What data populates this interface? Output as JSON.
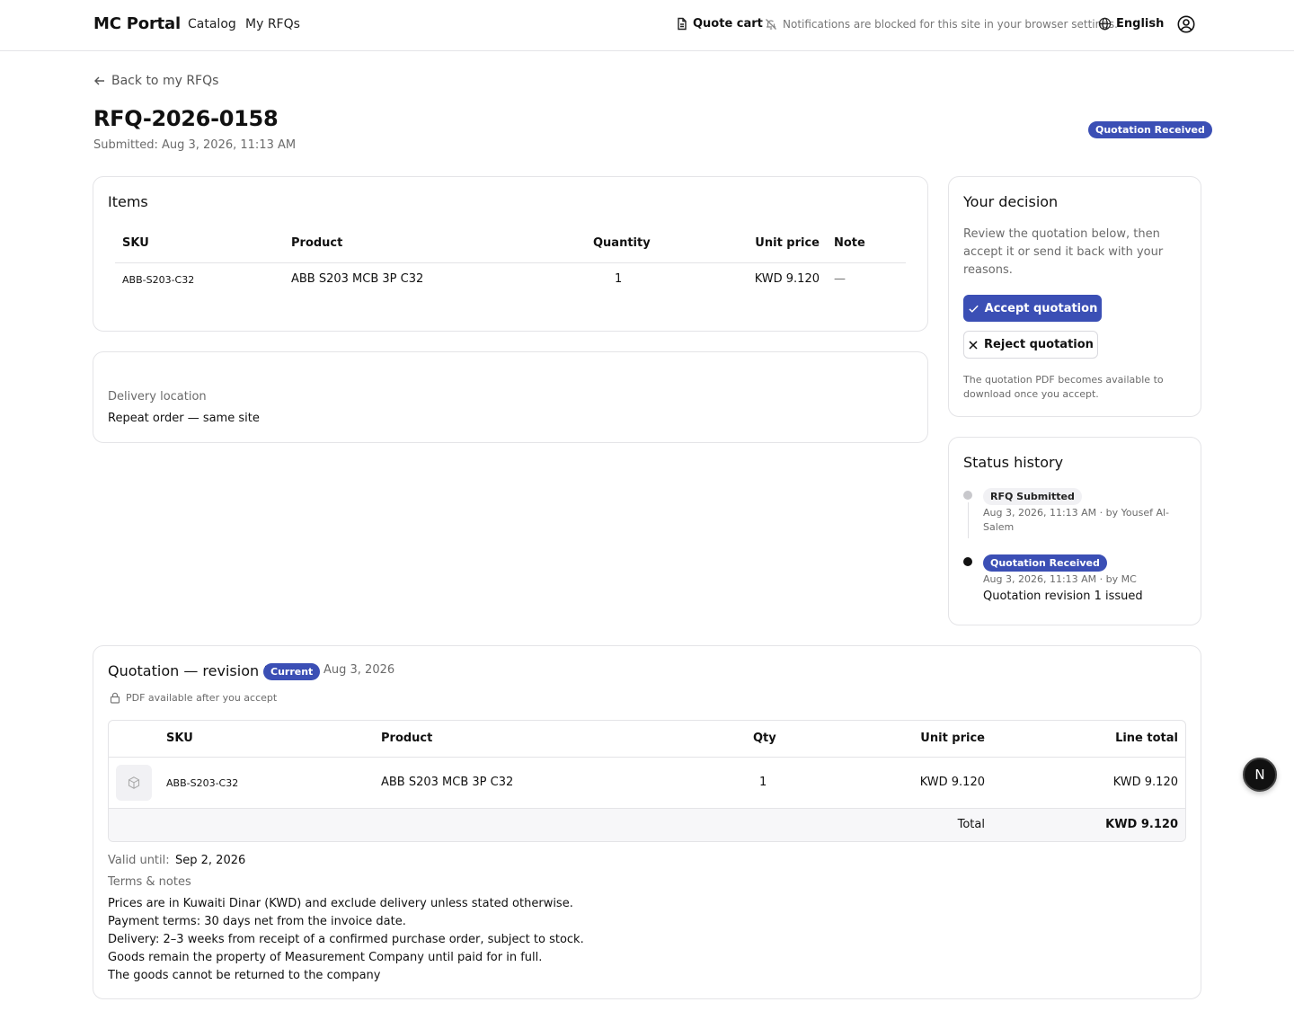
{
  "header": {
    "brand": "MC Portal",
    "nav": {
      "catalog": "Catalog",
      "my_rfqs": "My RFQs"
    },
    "quote_cart": "Quote cart",
    "notifications_text": "Notifications are blocked for this site in your browser settings.",
    "language": "English"
  },
  "page": {
    "back_link": "Back to my RFQs",
    "title": "RFQ-2026-0158",
    "submitted": "Submitted: Aug 3, 2026, 11:13 AM",
    "status": "Quotation Received"
  },
  "items": {
    "title": "Items",
    "columns": {
      "sku": "SKU",
      "product": "Product",
      "quantity": "Quantity",
      "unit_price": "Unit price",
      "note": "Note"
    },
    "rows": [
      {
        "sku": "ABB-S203-C32",
        "product": "ABB S203 MCB 3P C32",
        "quantity": "1",
        "unit_price": "KWD 9.120",
        "note": "—"
      }
    ]
  },
  "delivery": {
    "label": "Delivery location",
    "value": "Repeat order — same site"
  },
  "decision": {
    "title": "Your decision",
    "text": "Review the quotation below, then accept it or send it back with your reasons.",
    "accept_label": "Accept quotation",
    "reject_label": "Reject quotation",
    "note": "The quotation PDF becomes available to download once you accept."
  },
  "history": {
    "title": "Status history",
    "entries": [
      {
        "status": "RFQ Submitted",
        "meta": "Aug 3, 2026, 11:13 AM · by Yousef Al-Salem",
        "note": ""
      },
      {
        "status": "Quotation Received",
        "meta": "Aug 3, 2026, 11:13 AM · by MC",
        "note": "Quotation revision 1 issued"
      }
    ]
  },
  "quotation": {
    "title": "Quotation — revision 1",
    "current_badge": "Current",
    "date": "Aug 3, 2026",
    "pdf_note": "PDF available after you accept",
    "columns": {
      "sku": "SKU",
      "product": "Product",
      "qty": "Qty",
      "unit_price": "Unit price",
      "line_total": "Line total"
    },
    "rows": [
      {
        "sku": "ABB-S203-C32",
        "product": "ABB S203 MCB 3P C32",
        "qty": "1",
        "unit_price": "KWD 9.120",
        "line_total": "KWD 9.120"
      }
    ],
    "total_label": "Total",
    "total_value": "KWD 9.120",
    "valid_label": "Valid until:",
    "valid_value": "Sep 2, 2026",
    "terms_label": "Terms & notes",
    "terms": [
      "Prices are in Kuwaiti Dinar (KWD) and exclude delivery unless stated otherwise.",
      "Payment terms: 30 days net from the invoice date.",
      "Delivery: 2–3 weeks from receipt of a confirmed purchase order, subject to stock.",
      "Goods remain the property of Measurement Company until paid for in full.",
      "The goods cannot be returned to the company"
    ]
  },
  "fab_label": "N",
  "colors": {
    "accent": "#3b4fb5",
    "border": "#e4e4e7",
    "muted": "#6b6b6b"
  }
}
